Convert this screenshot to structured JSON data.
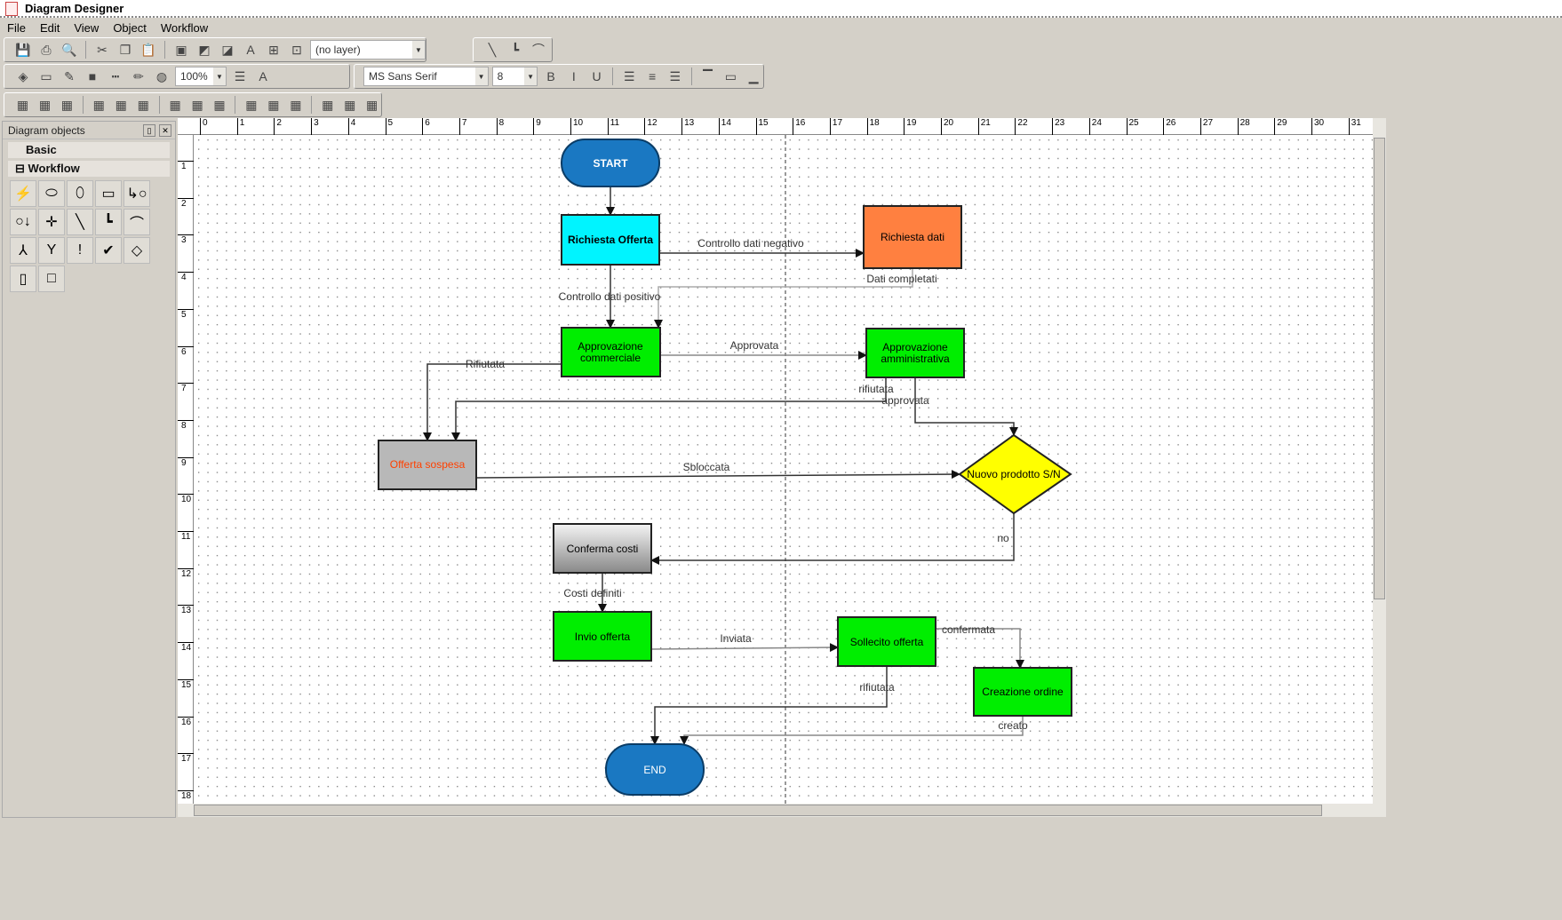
{
  "app": {
    "title": "Diagram Designer"
  },
  "menu": [
    "File",
    "Edit",
    "View",
    "Object",
    "Workflow"
  ],
  "toolbar": {
    "row1_icons": [
      "save-icon",
      "print-icon",
      "print-preview-icon",
      "|",
      "cut-icon",
      "copy-icon",
      "paste-icon",
      "|",
      "group-icon",
      "bring-front-icon",
      "send-back-icon",
      "text-icon",
      "fit-icon",
      "resize-icon"
    ],
    "layer": "(no layer)",
    "line_style_icons": [
      "straight-line-icon",
      "orthogonal-line-icon",
      "curved-line-icon"
    ],
    "zoom": "100%",
    "font": "MS Sans Serif",
    "font_size": "8",
    "format_icons": [
      "bold-icon",
      "italic-icon",
      "underline-icon",
      "|",
      "align-left-icon",
      "align-center-icon",
      "align-right-icon",
      "|",
      "valign-top-icon",
      "valign-middle-icon",
      "valign-bottom-icon"
    ],
    "row3_icons": [
      "align-lefts-icon",
      "align-rights-icon",
      "align-centers-icon",
      "|",
      "align-tops-icon",
      "align-bottoms-icon",
      "align-middles-icon",
      "|",
      "same-width-icon",
      "same-height-icon",
      "same-size-icon",
      "|",
      "space-horiz-icon",
      "space-horiz-inc-icon",
      "space-horiz-dec-icon",
      "|",
      "space-vert-icon",
      "space-vert-inc-icon",
      "space-vert-dec-icon"
    ]
  },
  "panel": {
    "title": "Diagram objects",
    "sections": [
      "Basic",
      "Workflow"
    ],
    "tools": [
      "event-icon",
      "start-icon",
      "end-icon",
      "process-icon",
      "connector-out-icon",
      "connector-in-icon",
      "junction-icon",
      "straight-link-icon",
      "orthogonal-link-icon",
      "curved-link-icon",
      "fork-icon",
      "merge-icon",
      "alert-icon",
      "approval-icon",
      "decision-icon",
      "subprocess-icon",
      "box-icon"
    ]
  },
  "ruler": {
    "top": [
      "0",
      "1",
      "2",
      "3",
      "4",
      "5",
      "6",
      "7",
      "8",
      "9",
      "10",
      "11",
      "12",
      "13",
      "14",
      "15",
      "16",
      "17",
      "18",
      "19",
      "20",
      "21",
      "22",
      "23",
      "24",
      "25",
      "26",
      "27",
      "28",
      "29",
      "30",
      "31"
    ],
    "left": [
      "1",
      "2",
      "3",
      "4",
      "5",
      "6",
      "7",
      "8",
      "9",
      "10",
      "11",
      "12",
      "13",
      "14",
      "15",
      "16",
      "17",
      "18"
    ]
  },
  "colors": {
    "start_end": "#1a78c2",
    "cyan": "#00f4ff",
    "orange": "#ff8040",
    "green": "#00ee00",
    "gray": "#b8b8b8",
    "yellow": "#ffff00",
    "red_text": "#ff4000"
  },
  "nodes": {
    "start": "START",
    "richiesta_offerta": "Richiesta Offerta",
    "richiesta_dati": "Richiesta dati",
    "approvazione_commerciale": [
      "Approvazione",
      "commerciale"
    ],
    "approvazione_amministrativa": [
      "Approvazione",
      "amministrativa"
    ],
    "offerta_sospesa": "Offerta sospesa",
    "nuovo_prodotto": "Nuovo prodotto S/N",
    "conferma_costi": "Conferma costi",
    "invio_offerta": "Invio offerta",
    "sollecito_offerta": "Sollecito offerta",
    "creazione_ordine": "Creazione ordine",
    "end": "END"
  },
  "edges": {
    "negativo": "Controllo dati negativo",
    "positivo": "Controllo dati positivo",
    "completati": "Dati completati",
    "approvata": "Approvata",
    "rifiutata1": "Rifiutata",
    "rifiutata2": "rifiutata",
    "approvata2": "approvata",
    "sbloccata": "Sbloccata",
    "no": "no",
    "costi": "Costi definiti",
    "inviata": "Inviata",
    "confermata": "confermata",
    "rifiutata3": "rifiutata",
    "creato": "creato"
  }
}
